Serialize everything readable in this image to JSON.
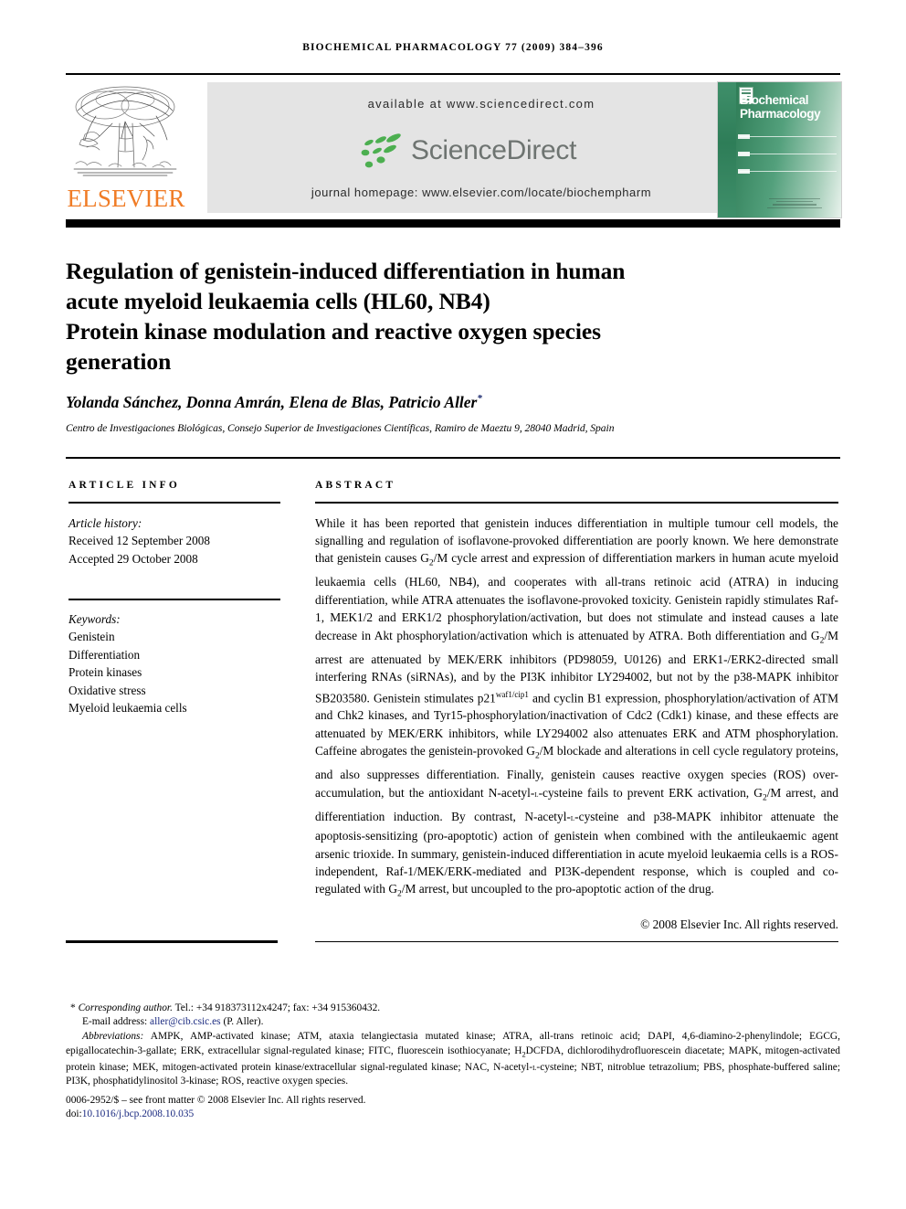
{
  "running_head": "Biochemical Pharmacology 77 (2009) 384–396",
  "masthead": {
    "publisher_name": "ELSEVIER",
    "available_at": "available at www.sciencedirect.com",
    "sciencedirect_word": "ScienceDirect",
    "journal_homepage": "journal homepage: www.elsevier.com/locate/biochempharm",
    "cover": {
      "title_line1": "Biochemical",
      "title_line2": "Pharmacology",
      "logo_caption": "ScienceDirect"
    }
  },
  "article": {
    "title_lines": [
      "Regulation of genistein-induced differentiation in human",
      "acute myeloid leukaemia cells (HL60, NB4)",
      "Protein kinase modulation and reactive oxygen species",
      "generation"
    ],
    "authors": "Yolanda Sánchez, Donna Amrán, Elena de Blas, Patricio Aller",
    "corresponding_marker": "*",
    "affiliation": "Centro de Investigaciones Biológicas, Consejo Superior de Investigaciones Científicas, Ramiro de Maeztu 9, 28040 Madrid, Spain"
  },
  "article_info": {
    "heading": "ARTICLE INFO",
    "history_label": "Article history:",
    "received": "Received 12 September 2008",
    "accepted": "Accepted 29 October 2008",
    "keywords_label": "Keywords:",
    "keywords": [
      "Genistein",
      "Differentiation",
      "Protein kinases",
      "Oxidative stress",
      "Myeloid leukaemia cells"
    ]
  },
  "abstract": {
    "heading": "ABSTRACT",
    "part1": "While it has been reported that genistein induces differentiation in multiple tumour cell models, the signalling and regulation of isoflavone-provoked differentiation are poorly known. We here demonstrate that genistein causes G",
    "sub1": "2",
    "part2": "/M cycle arrest and expression of differentiation markers in human acute myeloid leukaemia cells (HL60, NB4), and cooperates with all-trans retinoic acid (ATRA) in inducing differentiation, while ATRA attenuates the isoflavone-provoked toxicity. Genistein rapidly stimulates Raf-1, MEK1/2 and ERK1/2 phosphorylation/activation, but does not stimulate and instead causes a late decrease in Akt phosphorylation/activation which is attenuated by ATRA. Both differentiation and G",
    "sub2": "2",
    "part3": "/M arrest are attenuated by MEK/ERK inhibitors (PD98059, U0126) and ERK1-/ERK2-directed small interfering RNAs (siRNAs), and by the PI3K inhibitor LY294002, but not by the p38-MAPK inhibitor SB203580. Genistein stimulates p21",
    "sup1": "waf1/cip1",
    "part4": " and cyclin B1 expression, phosphorylation/activation of ATM and Chk2 kinases, and Tyr15-phosphorylation/inactivation of Cdc2 (Cdk1) kinase, and these effects are attenuated by MEK/ERK inhibitors, while LY294002 also attenuates ERK and ATM phosphorylation. Caffeine abrogates the genistein-provoked G",
    "sub3": "2",
    "part5": "/M blockade and alterations in cell cycle regulatory proteins, and also suppresses differentiation. Finally, genistein causes reactive oxygen species (ROS) over-accumulation, but the antioxidant N-acetyl-",
    "smallcap1": "l",
    "part6": "-cysteine fails to prevent ERK activation, G",
    "sub4": "2",
    "part7": "/M arrest, and differentiation induction. By contrast, N-acetyl-",
    "smallcap2": "l",
    "part8": "-cysteine and p38-MAPK inhibitor attenuate the apoptosis-sensitizing (pro-apoptotic) action of genistein when combined with the antileukaemic agent arsenic trioxide. In summary, genistein-induced differentiation in acute myeloid leukaemia cells is a ROS-independent, Raf-1/MEK/ERK-mediated and PI3K-dependent response, which is coupled and co-regulated with G",
    "sub5": "2",
    "part9": "/M arrest, but uncoupled to the pro-apoptotic action of the drug.",
    "copyright": "© 2008 Elsevier Inc. All rights reserved."
  },
  "footnotes": {
    "corresponding_star": "*",
    "corresponding_label": "Corresponding author.",
    "corresponding_contact": " Tel.: +34 918373112x4247; fax: +34 915360432.",
    "email_label": "E-mail address:",
    "email_address": "aller@cib.csic.es",
    "email_owner": "(P. Aller).",
    "abbreviations_label": "Abbreviations:",
    "abbrev_part1": " AMPK, AMP-activated kinase; ATM, ataxia telangiectasia mutated kinase; ATRA, all-trans retinoic acid; DAPI, 4,6-diamino-2-phenylindole; EGCG, epigallocatechin-3-gallate; ERK, extracellular signal-regulated kinase; FITC, fluorescein isothiocyanate; H",
    "abbrev_sub": "2",
    "abbrev_part2": "DCFDA, dichlorodihydrofluorescein diacetate; MAPK, mitogen-activated protein kinase; MEK, mitogen-activated protein kinase/extracellular signal-regulated kinase; NAC, N-acetyl-",
    "abbrev_smallcap": "l",
    "abbrev_part3": "-cysteine; NBT, nitroblue tetrazolium; PBS, phosphate-buffered saline; PI3K, phosphatidylinositol 3-kinase; ROS, reactive oxygen species.",
    "issn_line": "0006-2952/$ – see front matter © 2008 Elsevier Inc. All rights reserved.",
    "doi_label": "doi:",
    "doi_value": "10.1016/j.bcp.2008.10.035"
  },
  "colors": {
    "elsevier_orange": "#f07c26",
    "sciencedirect_green": "#4caf50",
    "sciencedirect_gray": "#6e7471",
    "cover_green": "#2f7d57",
    "link_blue": "#1b2a80"
  }
}
